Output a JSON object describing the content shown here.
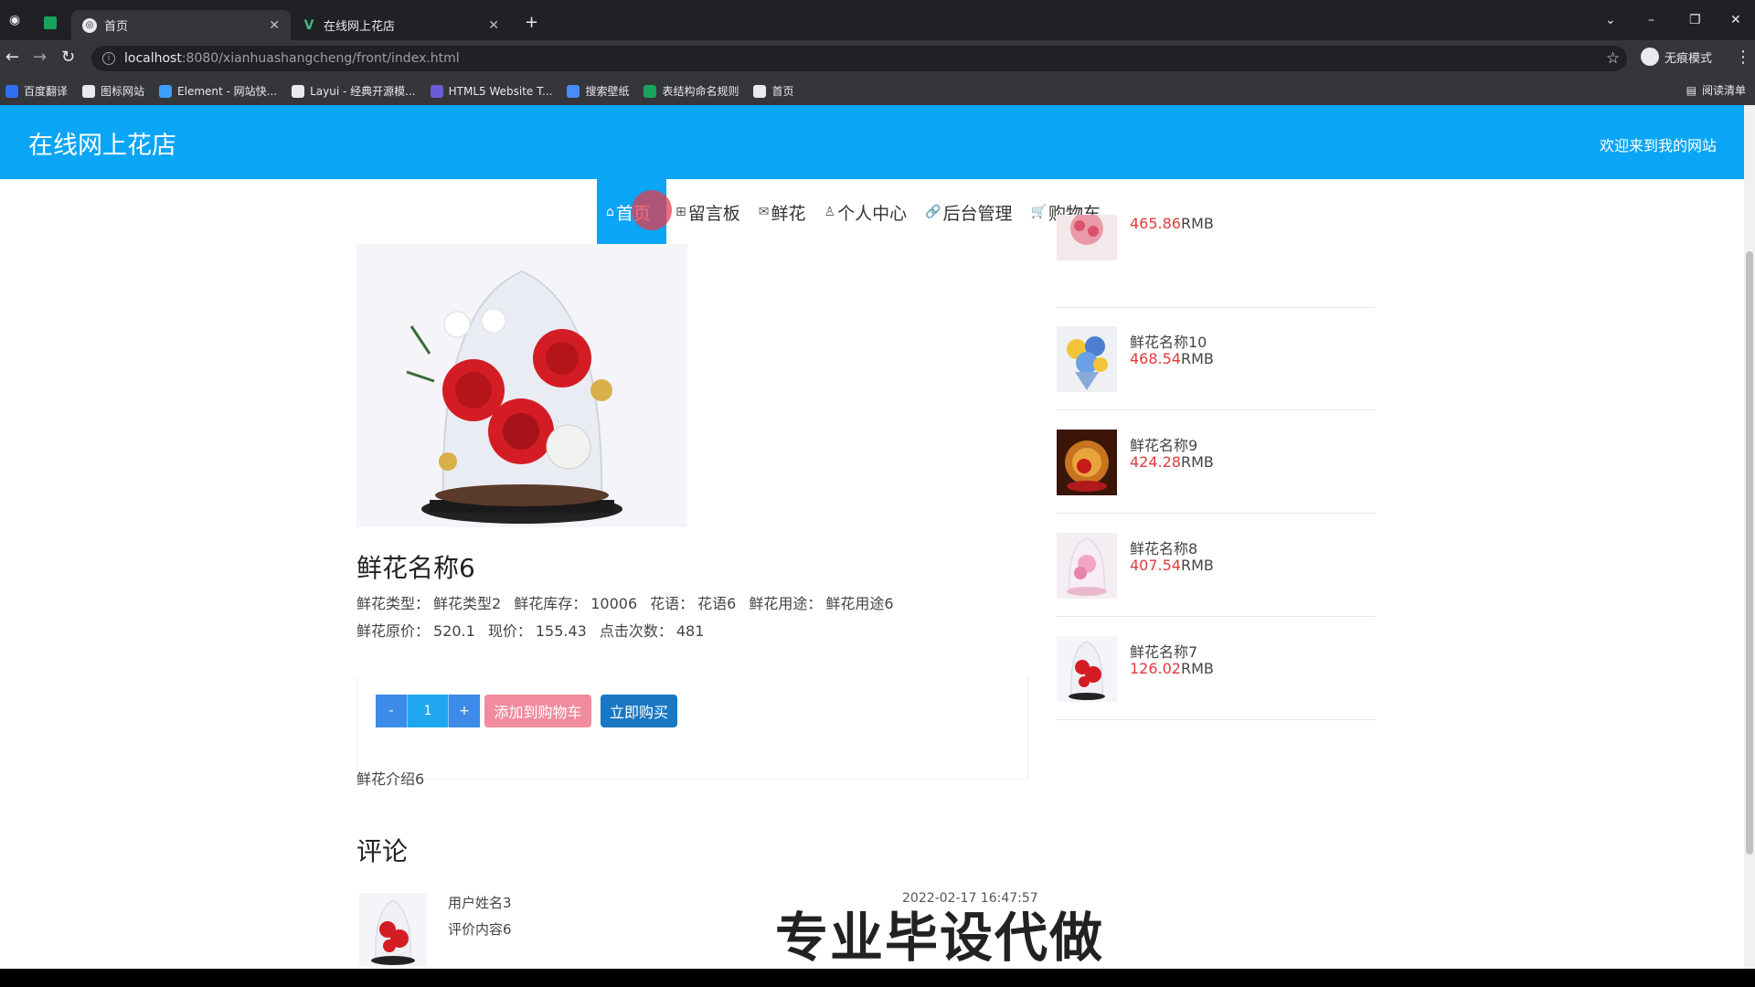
{
  "browser": {
    "tabs": [
      {
        "title": "首页",
        "active": true
      },
      {
        "title": "在线网上花店",
        "active": false
      }
    ],
    "url_host": "localhost",
    "url_path": ":8080/xianhuashangcheng/front/index.html",
    "profile_label": "无痕模式",
    "bookmarks": [
      {
        "label": "百度翻译",
        "color": "#2f6ff4"
      },
      {
        "label": "图标网站",
        "color": "#e8eaed"
      },
      {
        "label": "Element - 网站快...",
        "color": "#409eff"
      },
      {
        "label": "Layui - 经典开源模...",
        "color": "#e8eaed"
      },
      {
        "label": "HTML5 Website T...",
        "color": "#6b5bd6"
      },
      {
        "label": "搜索壁纸",
        "color": "#4a8cf7"
      },
      {
        "label": "表结构命名规则",
        "color": "#1aa35d"
      },
      {
        "label": "首页",
        "color": "#e8eaed"
      }
    ],
    "reading_list": "阅读清单"
  },
  "site": {
    "title": "在线网上花店",
    "welcome": "欢迎来到我的网站",
    "accent": "#0ba5f5",
    "nav": [
      {
        "icon": "home-icon",
        "glyph": "⌂",
        "label": "首页",
        "active": true
      },
      {
        "icon": "grid-icon",
        "glyph": "⊞",
        "label": "留言板",
        "active": false
      },
      {
        "icon": "mail-icon",
        "glyph": "✉",
        "label": "鲜花",
        "active": false
      },
      {
        "icon": "user-icon",
        "glyph": "♙",
        "label": "个人中心",
        "active": false
      },
      {
        "icon": "link-icon",
        "glyph": "🔗",
        "label": "后台管理",
        "active": false
      },
      {
        "icon": "cart-icon",
        "glyph": "🛒",
        "label": "购物车",
        "active": false
      }
    ]
  },
  "product": {
    "name": "鲜花名称6",
    "line1": [
      {
        "label": "鲜花类型：",
        "value": "鲜花类型2"
      },
      {
        "label": "鲜花库存：",
        "value": "10006"
      },
      {
        "label": "花语：",
        "value": "花语6"
      },
      {
        "label": "鲜花用途：",
        "value": "鲜花用途6"
      }
    ],
    "line2": [
      {
        "label": "鲜花原价：",
        "value": "520.1"
      },
      {
        "label": "现价：",
        "value": "155.43"
      },
      {
        "label": "点击次数：",
        "value": "481"
      }
    ],
    "quantity": "1",
    "minus_label": "-",
    "plus_label": "+",
    "add_cart_label": "添加到购物车",
    "buy_now_label": "立即购买",
    "intro": "鲜花介绍6"
  },
  "comments": {
    "heading": "评论",
    "items": [
      {
        "user": "用户姓名3",
        "content": "评价内容6",
        "time": "2022-02-17 16:47:57"
      }
    ]
  },
  "sidebar": {
    "price_color": "#e4393c",
    "currency": "RMB",
    "items": [
      {
        "name": "",
        "price": "465.86"
      },
      {
        "name": "鲜花名称10",
        "price": "468.54"
      },
      {
        "name": "鲜花名称9",
        "price": "424.28"
      },
      {
        "name": "鲜花名称8",
        "price": "407.54"
      },
      {
        "name": "鲜花名称7",
        "price": "126.02"
      }
    ]
  },
  "overlay": {
    "watermark": "专业毕设代做"
  }
}
